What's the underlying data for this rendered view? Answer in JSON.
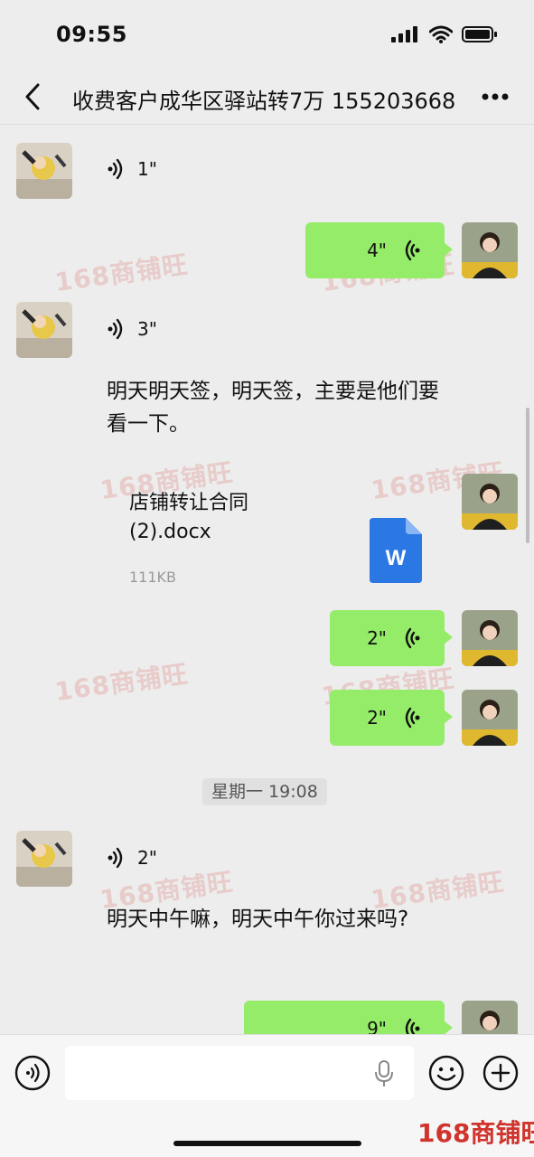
{
  "status_bar": {
    "time": "09:55"
  },
  "header": {
    "title": "收费客户成华区驿站转7万 155203668"
  },
  "messages": {
    "m1": {
      "duration": "1\""
    },
    "m2": {
      "duration": "4\""
    },
    "m3": {
      "duration": "3\""
    },
    "m4": {
      "text": "明天明天签，明天签，主要是他们要看一下。"
    },
    "file": {
      "name": "店铺转让合同(2).docx",
      "size": "111KB",
      "icon_letter": "W"
    },
    "m6": {
      "duration": "2\""
    },
    "m7": {
      "duration": "2\""
    },
    "time_divider": "星期一 19:08",
    "m8": {
      "duration": "2\""
    },
    "m9": {
      "text": "明天中午嘛，明天中午你过来吗?"
    },
    "m10": {
      "duration": "9\""
    }
  },
  "watermark": "168商铺旺",
  "colors": {
    "my_bubble": "#95ec69",
    "background": "#ededed",
    "word_icon": "#2b78e4",
    "logo": "#d0342c"
  }
}
